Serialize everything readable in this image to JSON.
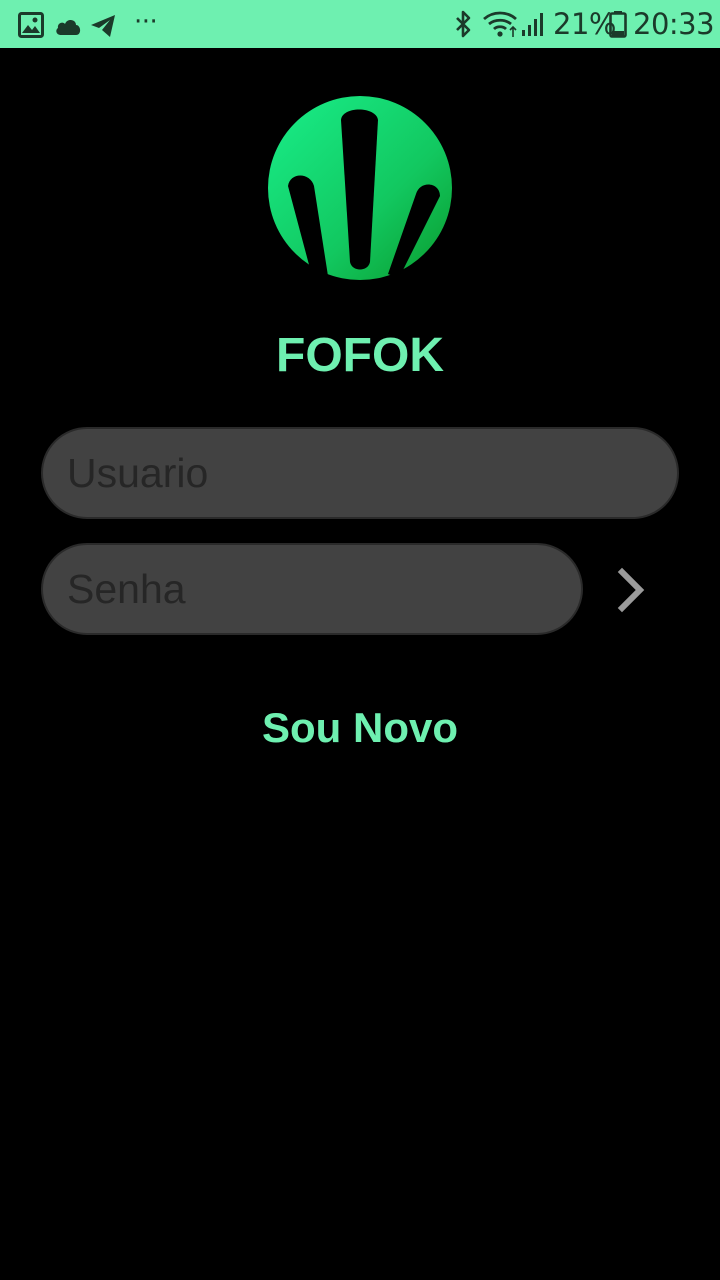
{
  "status_bar": {
    "battery": "21%",
    "time": "20:33",
    "more": "···",
    "left_icons": [
      "image-icon",
      "cloud-icon",
      "telegram-icon"
    ],
    "right_icons": [
      "bluetooth-icon",
      "wifi-icon",
      "signal-icon",
      "battery-icon"
    ]
  },
  "app": {
    "title": "FOFOK",
    "accent_color": "#6ef0b0",
    "logo_icon": "fofok-logo"
  },
  "login": {
    "username_placeholder": "Usuario",
    "password_placeholder": "Senha",
    "next_icon": "chevron-right-icon",
    "new_user_label": "Sou Novo"
  }
}
